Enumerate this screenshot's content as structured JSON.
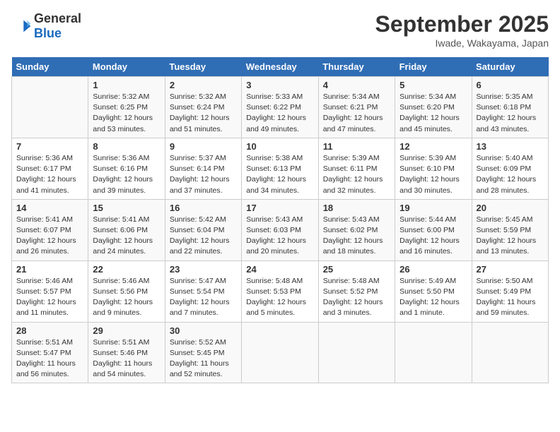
{
  "logo": {
    "general": "General",
    "blue": "Blue"
  },
  "header": {
    "month": "September 2025",
    "location": "Iwade, Wakayama, Japan"
  },
  "weekdays": [
    "Sunday",
    "Monday",
    "Tuesday",
    "Wednesday",
    "Thursday",
    "Friday",
    "Saturday"
  ],
  "weeks": [
    [
      {
        "day": null
      },
      {
        "day": "1",
        "sunrise": "Sunrise: 5:32 AM",
        "sunset": "Sunset: 6:25 PM",
        "daylight": "Daylight: 12 hours and 53 minutes."
      },
      {
        "day": "2",
        "sunrise": "Sunrise: 5:32 AM",
        "sunset": "Sunset: 6:24 PM",
        "daylight": "Daylight: 12 hours and 51 minutes."
      },
      {
        "day": "3",
        "sunrise": "Sunrise: 5:33 AM",
        "sunset": "Sunset: 6:22 PM",
        "daylight": "Daylight: 12 hours and 49 minutes."
      },
      {
        "day": "4",
        "sunrise": "Sunrise: 5:34 AM",
        "sunset": "Sunset: 6:21 PM",
        "daylight": "Daylight: 12 hours and 47 minutes."
      },
      {
        "day": "5",
        "sunrise": "Sunrise: 5:34 AM",
        "sunset": "Sunset: 6:20 PM",
        "daylight": "Daylight: 12 hours and 45 minutes."
      },
      {
        "day": "6",
        "sunrise": "Sunrise: 5:35 AM",
        "sunset": "Sunset: 6:18 PM",
        "daylight": "Daylight: 12 hours and 43 minutes."
      }
    ],
    [
      {
        "day": "7",
        "sunrise": "Sunrise: 5:36 AM",
        "sunset": "Sunset: 6:17 PM",
        "daylight": "Daylight: 12 hours and 41 minutes."
      },
      {
        "day": "8",
        "sunrise": "Sunrise: 5:36 AM",
        "sunset": "Sunset: 6:16 PM",
        "daylight": "Daylight: 12 hours and 39 minutes."
      },
      {
        "day": "9",
        "sunrise": "Sunrise: 5:37 AM",
        "sunset": "Sunset: 6:14 PM",
        "daylight": "Daylight: 12 hours and 37 minutes."
      },
      {
        "day": "10",
        "sunrise": "Sunrise: 5:38 AM",
        "sunset": "Sunset: 6:13 PM",
        "daylight": "Daylight: 12 hours and 34 minutes."
      },
      {
        "day": "11",
        "sunrise": "Sunrise: 5:39 AM",
        "sunset": "Sunset: 6:11 PM",
        "daylight": "Daylight: 12 hours and 32 minutes."
      },
      {
        "day": "12",
        "sunrise": "Sunrise: 5:39 AM",
        "sunset": "Sunset: 6:10 PM",
        "daylight": "Daylight: 12 hours and 30 minutes."
      },
      {
        "day": "13",
        "sunrise": "Sunrise: 5:40 AM",
        "sunset": "Sunset: 6:09 PM",
        "daylight": "Daylight: 12 hours and 28 minutes."
      }
    ],
    [
      {
        "day": "14",
        "sunrise": "Sunrise: 5:41 AM",
        "sunset": "Sunset: 6:07 PM",
        "daylight": "Daylight: 12 hours and 26 minutes."
      },
      {
        "day": "15",
        "sunrise": "Sunrise: 5:41 AM",
        "sunset": "Sunset: 6:06 PM",
        "daylight": "Daylight: 12 hours and 24 minutes."
      },
      {
        "day": "16",
        "sunrise": "Sunrise: 5:42 AM",
        "sunset": "Sunset: 6:04 PM",
        "daylight": "Daylight: 12 hours and 22 minutes."
      },
      {
        "day": "17",
        "sunrise": "Sunrise: 5:43 AM",
        "sunset": "Sunset: 6:03 PM",
        "daylight": "Daylight: 12 hours and 20 minutes."
      },
      {
        "day": "18",
        "sunrise": "Sunrise: 5:43 AM",
        "sunset": "Sunset: 6:02 PM",
        "daylight": "Daylight: 12 hours and 18 minutes."
      },
      {
        "day": "19",
        "sunrise": "Sunrise: 5:44 AM",
        "sunset": "Sunset: 6:00 PM",
        "daylight": "Daylight: 12 hours and 16 minutes."
      },
      {
        "day": "20",
        "sunrise": "Sunrise: 5:45 AM",
        "sunset": "Sunset: 5:59 PM",
        "daylight": "Daylight: 12 hours and 13 minutes."
      }
    ],
    [
      {
        "day": "21",
        "sunrise": "Sunrise: 5:46 AM",
        "sunset": "Sunset: 5:57 PM",
        "daylight": "Daylight: 12 hours and 11 minutes."
      },
      {
        "day": "22",
        "sunrise": "Sunrise: 5:46 AM",
        "sunset": "Sunset: 5:56 PM",
        "daylight": "Daylight: 12 hours and 9 minutes."
      },
      {
        "day": "23",
        "sunrise": "Sunrise: 5:47 AM",
        "sunset": "Sunset: 5:54 PM",
        "daylight": "Daylight: 12 hours and 7 minutes."
      },
      {
        "day": "24",
        "sunrise": "Sunrise: 5:48 AM",
        "sunset": "Sunset: 5:53 PM",
        "daylight": "Daylight: 12 hours and 5 minutes."
      },
      {
        "day": "25",
        "sunrise": "Sunrise: 5:48 AM",
        "sunset": "Sunset: 5:52 PM",
        "daylight": "Daylight: 12 hours and 3 minutes."
      },
      {
        "day": "26",
        "sunrise": "Sunrise: 5:49 AM",
        "sunset": "Sunset: 5:50 PM",
        "daylight": "Daylight: 12 hours and 1 minute."
      },
      {
        "day": "27",
        "sunrise": "Sunrise: 5:50 AM",
        "sunset": "Sunset: 5:49 PM",
        "daylight": "Daylight: 11 hours and 59 minutes."
      }
    ],
    [
      {
        "day": "28",
        "sunrise": "Sunrise: 5:51 AM",
        "sunset": "Sunset: 5:47 PM",
        "daylight": "Daylight: 11 hours and 56 minutes."
      },
      {
        "day": "29",
        "sunrise": "Sunrise: 5:51 AM",
        "sunset": "Sunset: 5:46 PM",
        "daylight": "Daylight: 11 hours and 54 minutes."
      },
      {
        "day": "30",
        "sunrise": "Sunrise: 5:52 AM",
        "sunset": "Sunset: 5:45 PM",
        "daylight": "Daylight: 11 hours and 52 minutes."
      },
      {
        "day": null
      },
      {
        "day": null
      },
      {
        "day": null
      },
      {
        "day": null
      }
    ]
  ]
}
